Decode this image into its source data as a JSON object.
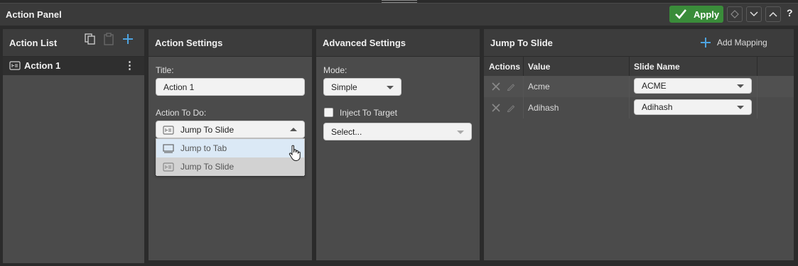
{
  "window": {
    "title": "Action Panel",
    "apply_label": "Apply",
    "help_label": "?"
  },
  "action_list": {
    "title": "Action List",
    "items": [
      {
        "label": "Action 1",
        "menu": "⋮"
      }
    ]
  },
  "action_settings": {
    "title": "Action Settings",
    "title_label": "Title:",
    "title_value": "Action 1",
    "action_label": "Action To Do:",
    "action_value": "Jump To Slide",
    "dropdown_options": [
      "Jump to Tab",
      "Jump To Slide"
    ]
  },
  "advanced_settings": {
    "title": "Advanced Settings",
    "mode_label": "Mode:",
    "mode_value": "Simple",
    "inject_label": "Inject To Target",
    "select_placeholder": "Select..."
  },
  "jump_to_slide": {
    "title": "Jump To Slide",
    "add_mapping_label": "Add Mapping",
    "columns": [
      "Actions",
      "Value",
      "Slide Name"
    ],
    "rows": [
      {
        "value": "Acme",
        "slide_name": "ACME"
      },
      {
        "value": "Adihash",
        "slide_name": "Adihash"
      }
    ]
  },
  "colors": {
    "accent": "#3a8c3a",
    "add_icon": "#4ea3e0"
  }
}
